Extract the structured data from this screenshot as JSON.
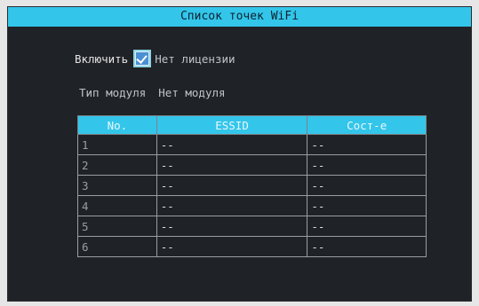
{
  "window": {
    "title": "Список точек WiFi"
  },
  "enable": {
    "label": "Включить",
    "checked": true,
    "status": "Нет лицензии"
  },
  "module": {
    "label": "Тип модуля",
    "value": "Нет модуля"
  },
  "table": {
    "headers": [
      "No.",
      "ESSID",
      "Сост-е"
    ],
    "rows": [
      {
        "no": "1",
        "essid": "--",
        "state": "--"
      },
      {
        "no": "2",
        "essid": "--",
        "state": "--"
      },
      {
        "no": "3",
        "essid": "--",
        "state": "--"
      },
      {
        "no": "4",
        "essid": "--",
        "state": "--"
      },
      {
        "no": "5",
        "essid": "--",
        "state": "--"
      },
      {
        "no": "6",
        "essid": "--",
        "state": "--"
      }
    ]
  },
  "colors": {
    "accent": "#33c6ea",
    "background": "#1f2226"
  },
  "icons": {
    "checkbox": "checkmark-icon"
  }
}
